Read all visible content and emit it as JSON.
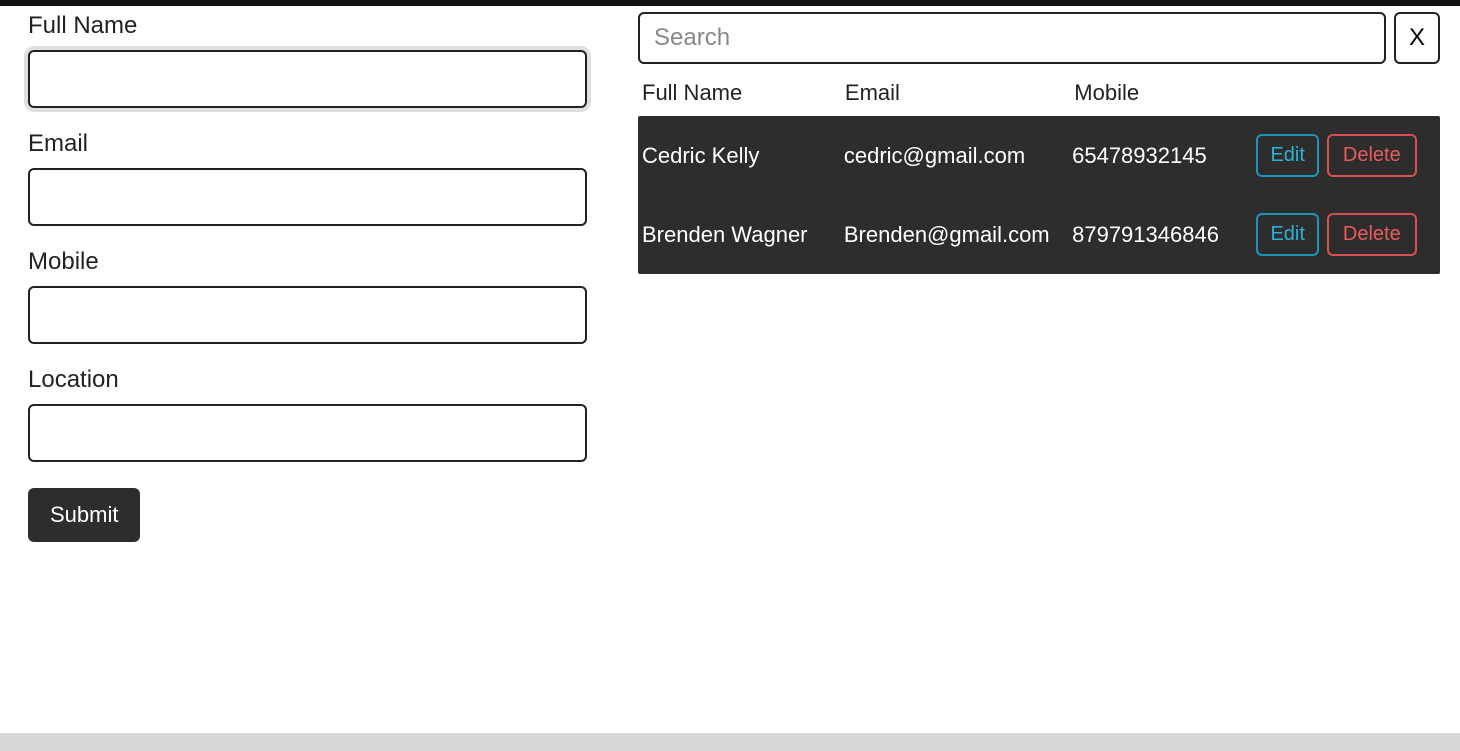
{
  "form": {
    "fullname": {
      "label": "Full Name",
      "value": ""
    },
    "email": {
      "label": "Email",
      "value": ""
    },
    "mobile": {
      "label": "Mobile",
      "value": ""
    },
    "location": {
      "label": "Location",
      "value": ""
    },
    "submit_label": "Submit"
  },
  "search": {
    "placeholder": "Search",
    "value": "",
    "clear_label": "X"
  },
  "table": {
    "headers": {
      "name": "Full Name",
      "email": "Email",
      "mobile": "Mobile"
    },
    "rows": [
      {
        "name": "Cedric Kelly",
        "email": "cedric@gmail.com",
        "mobile": "65478932145",
        "edit_label": "Edit",
        "delete_label": "Delete"
      },
      {
        "name": "Brenden Wagner",
        "email": "Brenden@gmail.com",
        "mobile": "879791346846",
        "edit_label": "Edit",
        "delete_label": "Delete"
      }
    ]
  }
}
